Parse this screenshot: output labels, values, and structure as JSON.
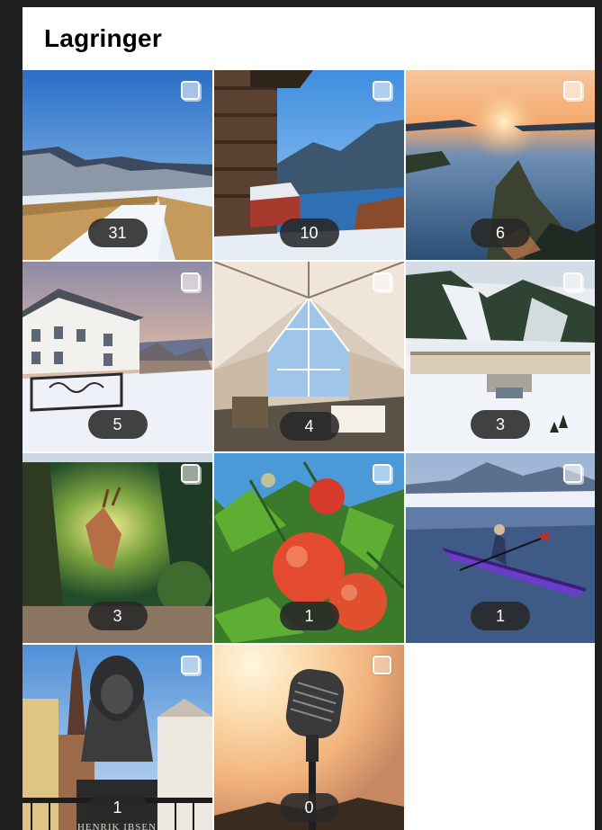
{
  "header": {
    "title": "Lagringer"
  },
  "tiles": [
    {
      "count": "31",
      "scene": "snow-boardwalk"
    },
    {
      "count": "10",
      "scene": "fjord-cabin"
    },
    {
      "count": "6",
      "scene": "archipelago-sunset"
    },
    {
      "count": "5",
      "scene": "winter-villa"
    },
    {
      "count": "4",
      "scene": "glamping-dome"
    },
    {
      "count": "3",
      "scene": "ski-hotel"
    },
    {
      "count": "3",
      "scene": "forest-mural"
    },
    {
      "count": "1",
      "scene": "red-apples"
    },
    {
      "count": "1",
      "scene": "kayak-lake"
    },
    {
      "count": "1",
      "scene": "ibsen-statue",
      "caption": "HENRIK IBSEN"
    },
    {
      "count": "0",
      "scene": "microphone-sunset"
    }
  ]
}
